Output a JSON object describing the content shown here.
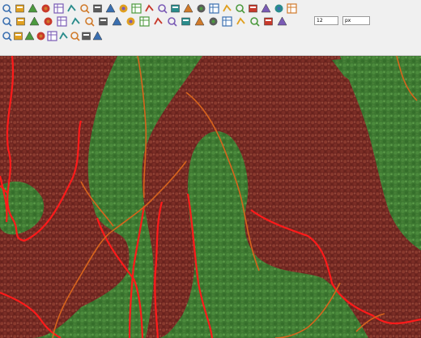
{
  "toolbar": {
    "row1_icons": [
      "zoom-in-icon",
      "zoom-out-icon",
      "zoom-layer-icon",
      "zoom-selection-icon",
      "pan-icon",
      "new-map-view-icon",
      "new-3d-view-icon",
      "bookmark-icon",
      "show-bookmarks-icon",
      "temporal-controller-icon",
      "refresh-icon",
      "identify-icon",
      "attribute-table-icon",
      "field-calculator-icon",
      "processing-toolbox-icon",
      "statistics-icon",
      "measure-icon",
      "annotation-icon",
      "map-tips-icon",
      "select-features-icon",
      "deselect-icon",
      "python-console-icon",
      "label-tool-icon"
    ],
    "row2_icons": [
      "current-edits-icon",
      "toggle-editing-icon",
      "save-edits-icon",
      "add-point-icon",
      "vertex-tool-icon",
      "delete-selected-icon",
      "cut-features-icon",
      "copy-features-icon",
      "paste-features-icon",
      "undo-icon",
      "redo-icon",
      "label-icon",
      "pin-labels-icon",
      "rotate-label-icon",
      "label-properties-icon",
      "change-label-icon",
      "show-hide-labels-icon",
      "python-icon",
      "plugin-icon",
      "magnet-snapping-icon",
      "snapping-mode-icon"
    ],
    "row3_icons": [
      "digitize-icon",
      "pencil-icon",
      "split-features-icon",
      "merge-features-icon",
      "reshape-icon",
      "offset-curve-icon",
      "simplify-icon",
      "trim-extend-icon",
      "advanced-digitizing-icon"
    ],
    "tolerance_value": "12",
    "tolerance_unit": "px"
  },
  "map": {
    "colors": {
      "forest": "#3f7a33",
      "cleared": "#7a2a22",
      "boundary_red": "#ff1a1a",
      "boundary_orange": "#d8641c"
    }
  }
}
